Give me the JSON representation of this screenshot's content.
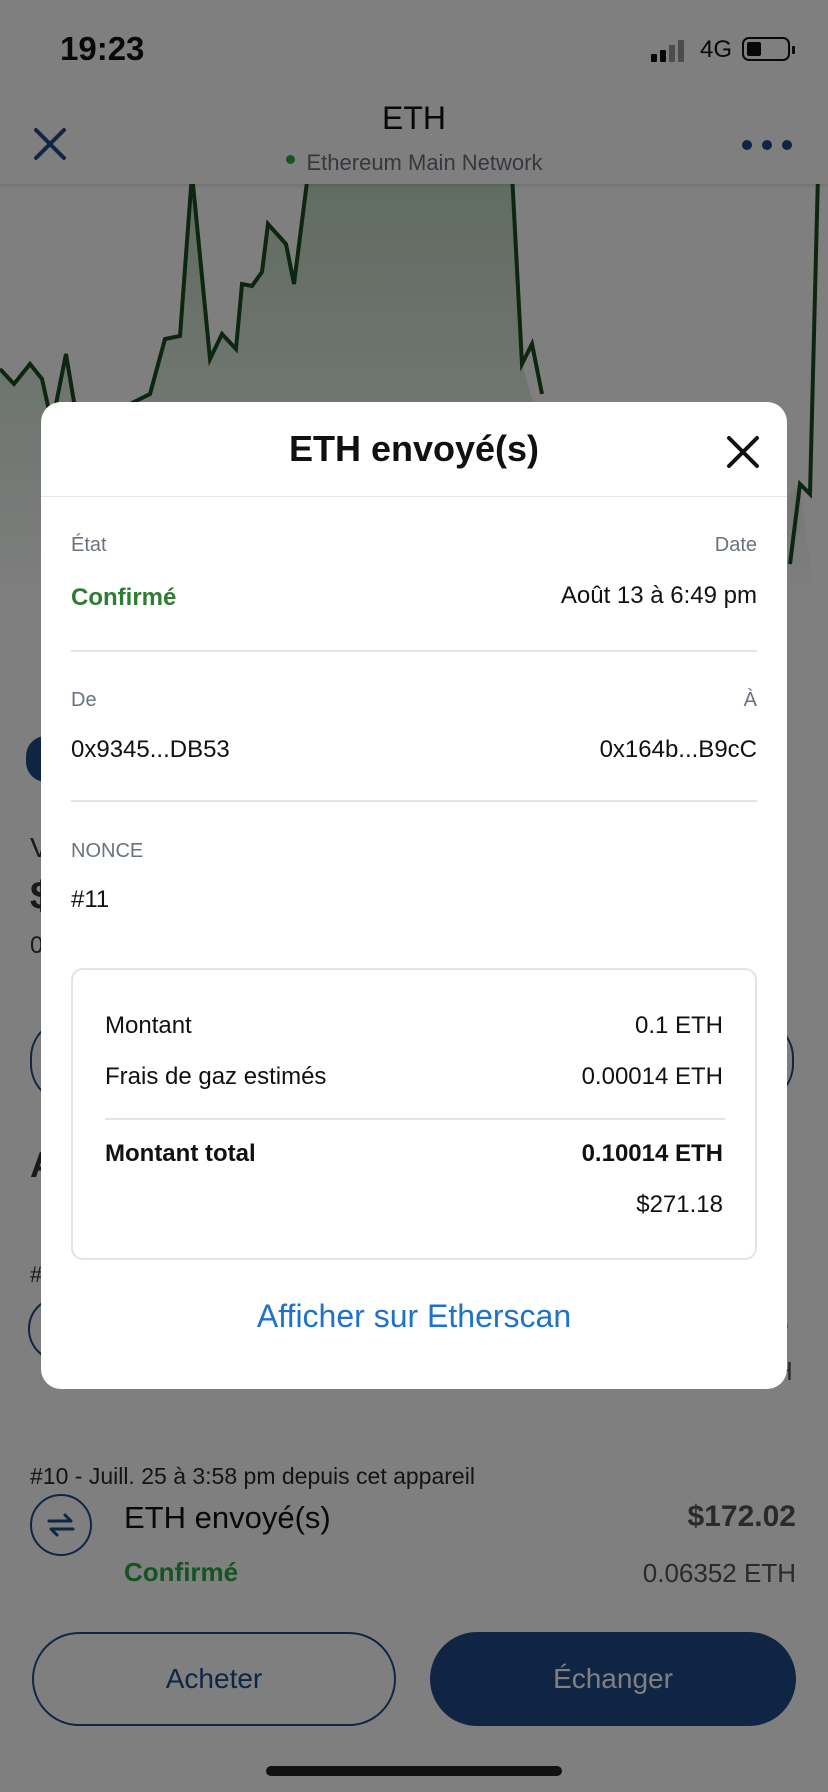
{
  "status_bar": {
    "time": "19:23",
    "network": "4G"
  },
  "header": {
    "title": "ETH",
    "network": "Ethereum Main Network"
  },
  "background": {
    "left_fragments": [
      "V",
      "$",
      "0"
    ],
    "section_fragment": "A",
    "nonce_fragment": "#",
    "right_value_fragment": "2",
    "right_unit_fragment": "H",
    "tx": {
      "meta": "#10 - Juill. 25 à 3:58 pm depuis cet appareil",
      "title": "ETH envoyé(s)",
      "status": "Confirmé",
      "fiat": "$172.02",
      "amount": "0.06352 ETH"
    },
    "buttons": {
      "buy": "Acheter",
      "swap": "Échanger"
    }
  },
  "modal": {
    "title": "ETH envoyé(s)",
    "state_label": "État",
    "state_value": "Confirmé",
    "date_label": "Date",
    "date_value": "Août 13 à 6:49 pm",
    "from_label": "De",
    "from_value": "0x9345...DB53",
    "to_label": "À",
    "to_value": "0x164b...B9cC",
    "nonce_label": "NONCE",
    "nonce_value": "#11",
    "summary": {
      "amount_label": "Montant",
      "amount_value": "0.1 ETH",
      "gas_label": "Frais de gaz estimés",
      "gas_value": "0.00014 ETH",
      "total_label": "Montant total",
      "total_value": "0.10014 ETH",
      "total_fiat": "$271.18"
    },
    "etherscan_link": "Afficher sur Etherscan"
  },
  "colors": {
    "accent": "#1e4a86",
    "success": "#2f7d32",
    "link": "#1e73c9",
    "chart_line": "#1b4d1f"
  },
  "icons": [
    "signal-icon",
    "battery-icon",
    "close-icon",
    "more-icon",
    "swap-arrows-icon"
  ]
}
